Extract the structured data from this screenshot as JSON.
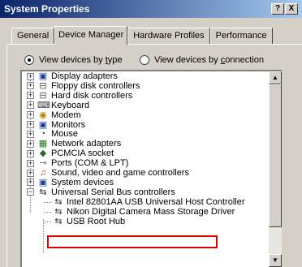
{
  "window": {
    "title": "System Properties",
    "help_glyph": "?",
    "close_glyph": "X"
  },
  "tabs": [
    {
      "label": "General"
    },
    {
      "label": "Device Manager"
    },
    {
      "label": "Hardware Profiles"
    },
    {
      "label": "Performance"
    }
  ],
  "view": {
    "by_type_prefix": "View devices by ",
    "by_type_key": "t",
    "by_type_rest": "ype",
    "by_connection_prefix": "View devices by ",
    "by_connection_key": "c",
    "by_connection_rest": "onnection",
    "selected": "by_type"
  },
  "tree": [
    {
      "label": "Display adapters",
      "icon": "display-adapter-icon",
      "glyph": "▣",
      "color": "#1f3f9f"
    },
    {
      "label": "Floppy disk controllers",
      "icon": "floppy-controller-icon",
      "glyph": "⊟",
      "color": "#505050"
    },
    {
      "label": "Hard disk controllers",
      "icon": "hard-disk-controller-icon",
      "glyph": "⊟",
      "color": "#505050"
    },
    {
      "label": "Keyboard",
      "icon": "keyboard-icon",
      "glyph": "⌨",
      "color": "#404040"
    },
    {
      "label": "Modem",
      "icon": "modem-icon",
      "glyph": "◉",
      "color": "#b08000"
    },
    {
      "label": "Monitors",
      "icon": "monitor-icon",
      "glyph": "▣",
      "color": "#1f3f9f"
    },
    {
      "label": "Mouse",
      "icon": "mouse-icon",
      "glyph": "◔",
      "color": "#404040"
    },
    {
      "label": "Network adapters",
      "icon": "network-adapter-icon",
      "glyph": "▦",
      "color": "#1a7a1a"
    },
    {
      "label": "PCMCIA socket",
      "icon": "pcmcia-icon",
      "glyph": "◆",
      "color": "#2a6a2a"
    },
    {
      "label": "Ports (COM & LPT)",
      "icon": "ports-icon",
      "glyph": "⊸",
      "color": "#606060"
    },
    {
      "label": "Sound, video and game controllers",
      "icon": "sound-icon",
      "glyph": "♫",
      "color": "#806000"
    },
    {
      "label": "System devices",
      "icon": "system-devices-icon",
      "glyph": "▣",
      "color": "#1f3f9f"
    },
    {
      "label": "Universal Serial Bus controllers",
      "icon": "usb-controllers-icon",
      "glyph": "⇆",
      "color": "#303030"
    },
    {
      "label": "Intel 82801AA USB Universal Host Controller",
      "icon": "usb-device-icon",
      "glyph": "⇆",
      "color": "#303030"
    },
    {
      "label": "Nikon Digital Camera Mass Storage Driver",
      "icon": "usb-device-icon",
      "glyph": "⇆",
      "color": "#303030"
    },
    {
      "label": "USB Root Hub",
      "icon": "usb-device-icon",
      "glyph": "⇆",
      "color": "#303030"
    }
  ],
  "expanders": {
    "collapsed": "+",
    "expanded": "−"
  },
  "scroll": {
    "up": "▲",
    "down": "▼"
  },
  "accent": {
    "highlight_border": "#e00000",
    "titlebar": "#0a246a"
  }
}
